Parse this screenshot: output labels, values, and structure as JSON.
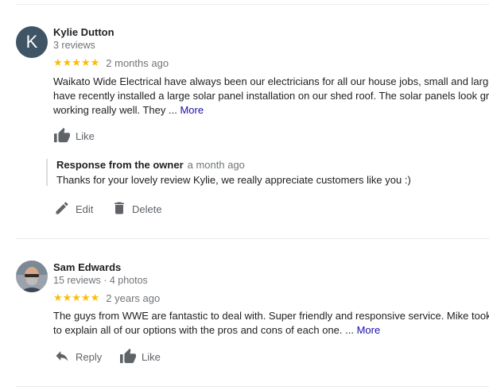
{
  "colors": {
    "star": "#fbbc04",
    "link": "#1a0dab",
    "avatar_bg": "#3f5465"
  },
  "reviews": [
    {
      "avatar_letter": "K",
      "name": "Kylie Dutton",
      "meta": "3 reviews",
      "stars": "★★★★★",
      "date": "2 months ago",
      "text_line1": "Waikato Wide Electrical have always been our electricians for all our house jobs, small and large.",
      "text_line2": "have recently installed a large solar panel installation on our shed roof.  The solar panels look grea",
      "text_line3": "working really well.  They ...",
      "more_label": "More",
      "like_label": "Like",
      "owner_response": {
        "title": "Response from the owner",
        "date": "a month ago",
        "text": "Thanks for your lovely review Kylie, we really appreciate customers like you :)"
      },
      "edit_label": "Edit",
      "delete_label": "Delete"
    },
    {
      "name": "Sam Edwards",
      "meta": "15 reviews · 4 photos",
      "stars": "★★★★★",
      "date": "2 years ago",
      "text_line1": "The guys from WWE are fantastic to deal with. Super friendly and responsive service. Mike took h",
      "text_line2": "to explain all of our options with the pros and cons of each one. ...",
      "more_label": "More",
      "reply_label": "Reply",
      "like_label": "Like"
    }
  ]
}
